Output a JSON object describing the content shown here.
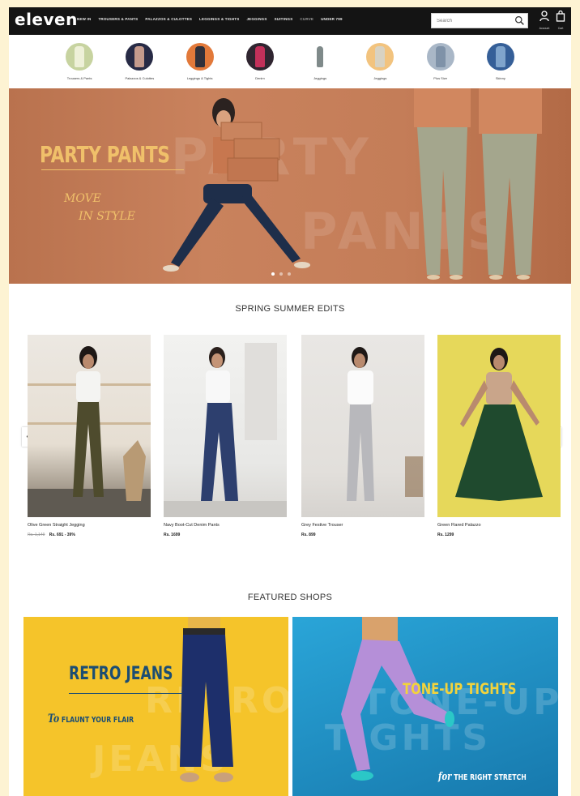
{
  "brand": {
    "logo": "eleven"
  },
  "nav": {
    "items": [
      {
        "label": "NEW IN"
      },
      {
        "label": "TROUSERS & PANTS"
      },
      {
        "label": "PALAZZOS & CULOTTES"
      },
      {
        "label": "LEGGINGS & TIGHTS"
      },
      {
        "label": "JEGGINGS"
      },
      {
        "label": "SUITINGS"
      },
      {
        "label": "CURVE"
      },
      {
        "label": "UNDER 799"
      }
    ]
  },
  "search": {
    "placeholder": "Search"
  },
  "header_icons": {
    "account_label": "Account",
    "cart_label": "Cart"
  },
  "categories": [
    {
      "label": "Trousers & Pants",
      "color": "#c7d3a0",
      "leg": "#e8ead0"
    },
    {
      "label": "Palazzos & Culottes",
      "color": "#272a45",
      "leg": "#c49a8c"
    },
    {
      "label": "Leggings & Tights",
      "color": "#e2793a",
      "leg": "#30303a"
    },
    {
      "label": "Denim",
      "color": "#2f2530",
      "leg": "#c2305a"
    },
    {
      "label": "Jeggings",
      "color": "#ffffff",
      "leg": "#7f8a8a"
    },
    {
      "label": "Jeggings",
      "color": "#f2c37e",
      "leg": "#d8d2c2"
    },
    {
      "label": "Plus Size",
      "color": "#a9b7c7",
      "leg": "#7f92a8"
    },
    {
      "label": "Skinny",
      "color": "#355f98",
      "leg": "#7fa4cc"
    }
  ],
  "hero": {
    "title": "PARTY PANTS",
    "tagline_line1": "MOVE",
    "tagline_line2": "IN STYLE",
    "ghost_text_1": "PARTY",
    "ghost_text_2": "PANTS"
  },
  "spring_summer": {
    "title": "SPRING SUMMER EDITS",
    "products": [
      {
        "name": "Olive Green Straight Jegging",
        "old_price": "Rs. 1,149",
        "price": "Rs. 691 - 39%"
      },
      {
        "name": "Navy Boot-Cut Denim Pants",
        "old_price": "",
        "price": "Rs. 1699"
      },
      {
        "name": "Grey Festive Trouser",
        "old_price": "",
        "price": "Rs. 899"
      },
      {
        "name": "Green Flared Palazzo",
        "old_price": "",
        "price": "Rs. 1299"
      }
    ]
  },
  "featured": {
    "title": "FEATURED SHOPS",
    "shops": [
      {
        "title": "RETRO JEANS",
        "subtitle": "FLAUNT YOUR FLAIR",
        "ghost1": "RETRO",
        "ghost2": "JEANS",
        "bg": "#f5c42a"
      },
      {
        "title": "TONE-UP TIGHTS",
        "subtitle": "THE RIGHT STRETCH",
        "ghost1": "TONE-UP",
        "ghost2": "TIGHTS",
        "bg": "#1d93c4"
      }
    ]
  }
}
